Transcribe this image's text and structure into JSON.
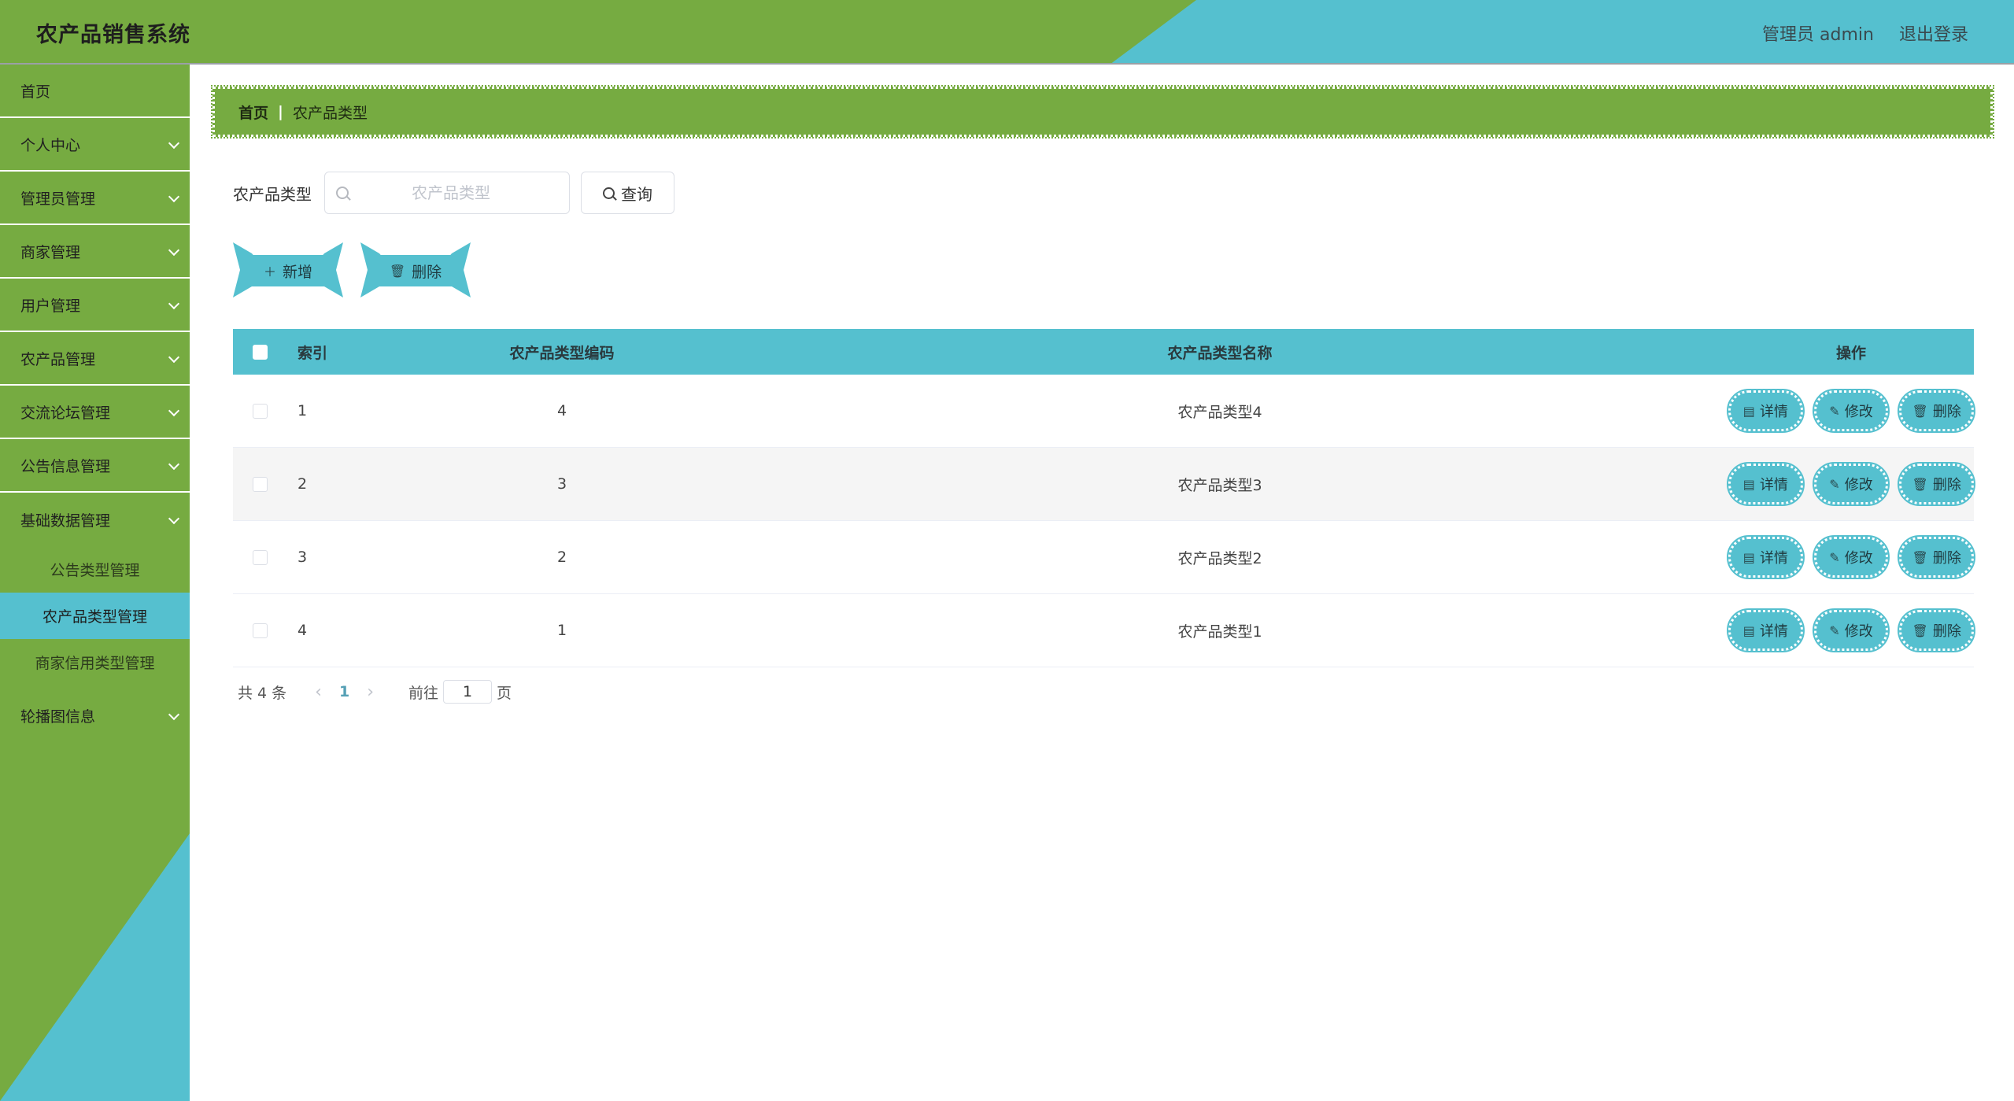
{
  "header": {
    "title": "农产品销售系统",
    "user_label": "管理员 admin",
    "logout_label": "退出登录"
  },
  "sidebar": {
    "items": [
      {
        "label": "首页",
        "has_children": false
      },
      {
        "label": "个人中心",
        "has_children": true
      },
      {
        "label": "管理员管理",
        "has_children": true
      },
      {
        "label": "商家管理",
        "has_children": true
      },
      {
        "label": "用户管理",
        "has_children": true
      },
      {
        "label": "农产品管理",
        "has_children": true
      },
      {
        "label": "交流论坛管理",
        "has_children": true
      },
      {
        "label": "公告信息管理",
        "has_children": true
      },
      {
        "label": "基础数据管理",
        "has_children": true,
        "open": true
      }
    ],
    "submenu": [
      {
        "label": "公告类型管理",
        "active": false
      },
      {
        "label": "农产品类型管理",
        "active": true
      },
      {
        "label": "商家信用类型管理",
        "active": false
      }
    ],
    "last_item": {
      "label": "轮播图信息"
    }
  },
  "breadcrumb": {
    "home": "首页",
    "separator": "|",
    "current": "农产品类型"
  },
  "search": {
    "label": "农产品类型",
    "placeholder": "农产品类型",
    "value": "",
    "button_label": "查询"
  },
  "actions": {
    "add_label": "新增",
    "delete_label": "删除"
  },
  "table": {
    "columns": [
      "索引",
      "农产品类型编码",
      "农产品类型名称",
      "操作"
    ],
    "rows": [
      {
        "index": "1",
        "code": "4",
        "name": "农产品类型4"
      },
      {
        "index": "2",
        "code": "3",
        "name": "农产品类型3"
      },
      {
        "index": "3",
        "code": "2",
        "name": "农产品类型2"
      },
      {
        "index": "4",
        "code": "1",
        "name": "农产品类型1"
      }
    ],
    "row_actions": {
      "detail": "详情",
      "edit": "修改",
      "delete": "删除"
    }
  },
  "pagination": {
    "total_text": "共 4 条",
    "current_page": "1",
    "goto_prefix": "前往",
    "goto_value": "1",
    "goto_suffix": "页"
  },
  "colors": {
    "green": "#76ab41",
    "teal": "#55c0cf"
  },
  "icons": {
    "add": "plus-icon",
    "delete": "trash-icon",
    "detail": "document-icon",
    "edit": "pencil-icon",
    "search": "search-icon",
    "submenu": "chevron-down-icon"
  }
}
